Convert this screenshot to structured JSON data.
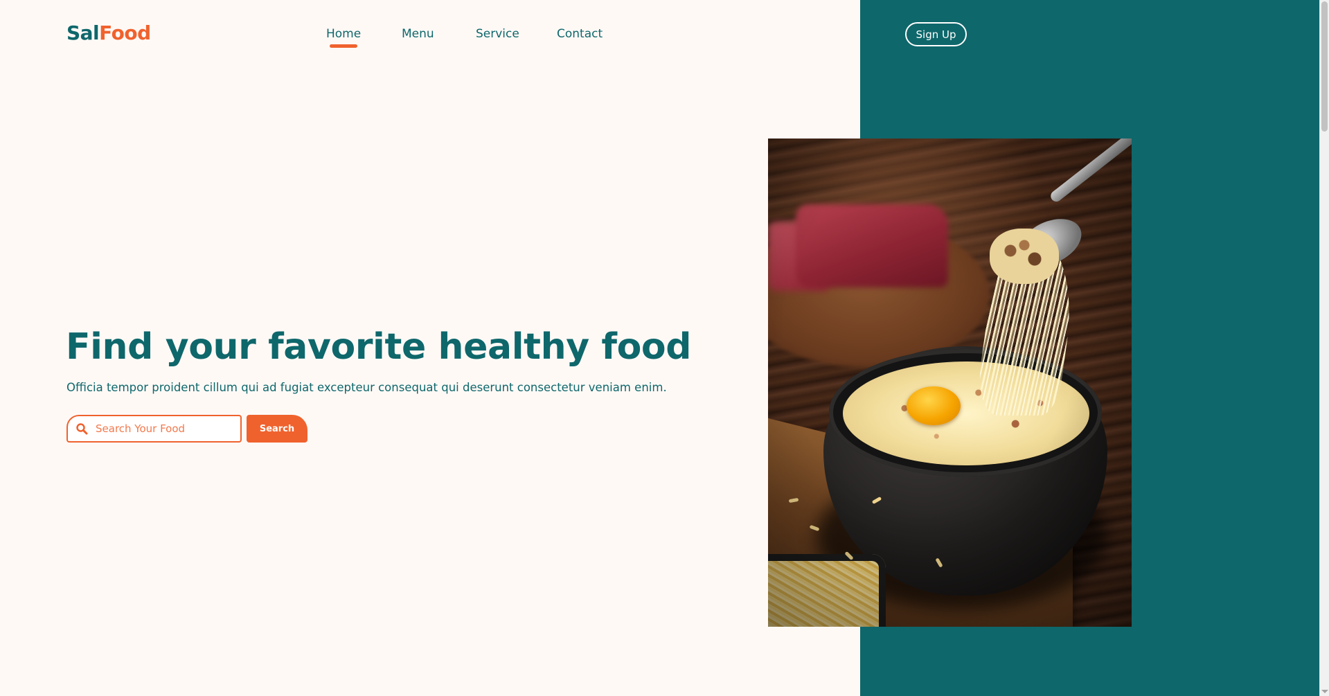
{
  "brand": {
    "part1": "Sal",
    "part2": "Food"
  },
  "nav": {
    "items": [
      {
        "label": "Home",
        "active": true
      },
      {
        "label": "Menu",
        "active": false
      },
      {
        "label": "Service",
        "active": false
      },
      {
        "label": "Contact",
        "active": false
      }
    ],
    "signup_label": "Sign Up"
  },
  "hero": {
    "title": "Find your favorite healthy food",
    "subtitle": "Officia tempor proident cillum qui ad fugiat excepteur consequat qui deserunt consectetur veniam enim.",
    "search": {
      "placeholder": "Search Your Food",
      "value": "",
      "button_label": "Search",
      "icon": "search-icon"
    }
  },
  "image": {
    "subject": "bowl-of-food-photo"
  },
  "colors": {
    "brand_teal": "#0e676b",
    "accent_orange": "#f0622d",
    "page_background": "#fff9f6"
  }
}
